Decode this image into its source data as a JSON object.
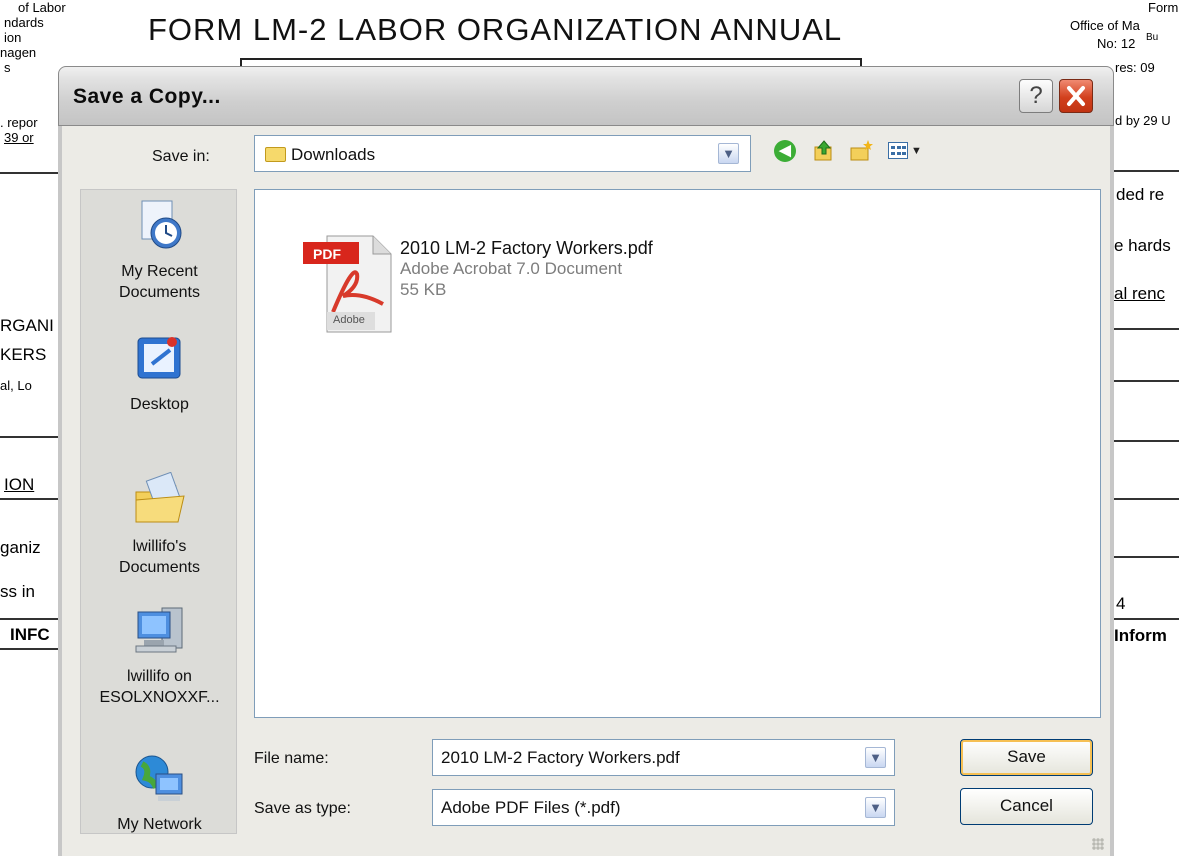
{
  "background": {
    "form_title": "FORM LM-2 LABOR ORGANIZATION ANNUAL",
    "left_fragments": [
      "of Labor",
      "ndards",
      "ion",
      "nagen",
      "s",
      ". repor",
      "39 or",
      "RGANI",
      "KERS",
      "al, Lo",
      "ION",
      "ganiz",
      "ss in",
      "INFC"
    ],
    "right_fragments": [
      "Form",
      "Office of Ma",
      "No:  12",
      "Bu",
      "res:  09",
      "d by 29 U",
      "ded re",
      "e hards",
      "al renc",
      "4",
      "Inform"
    ]
  },
  "dialog": {
    "title": "Save a Copy...",
    "help_label": "?",
    "save_in_label": "Save in:",
    "save_in_value": "Downloads",
    "places": [
      {
        "label": "My Recent Documents",
        "icon": "recent-documents-icon"
      },
      {
        "label": "Desktop",
        "icon": "desktop-icon"
      },
      {
        "label": "lwillifo's Documents",
        "icon": "my-documents-icon"
      },
      {
        "label": "lwillifo on ESOLXNOXXF...",
        "icon": "my-computer-icon"
      },
      {
        "label": "My Network",
        "icon": "network-icon"
      }
    ],
    "file": {
      "name": "2010 LM-2 Factory Workers.pdf",
      "type": "Adobe Acrobat 7.0 Document",
      "size": "55 KB",
      "icon_badge": "PDF",
      "icon_brand": "Adobe"
    },
    "file_name_label": "File name:",
    "file_name_value": "2010 LM-2 Factory Workers.pdf",
    "save_as_type_label": "Save as type:",
    "save_as_type_value": "Adobe PDF Files (*.pdf)",
    "save_label": "Save",
    "cancel_label": "Cancel"
  },
  "colors": {
    "accent": "#d2401d",
    "select_border": "#7f9db9",
    "dialog_bg": "#ecebe6"
  }
}
